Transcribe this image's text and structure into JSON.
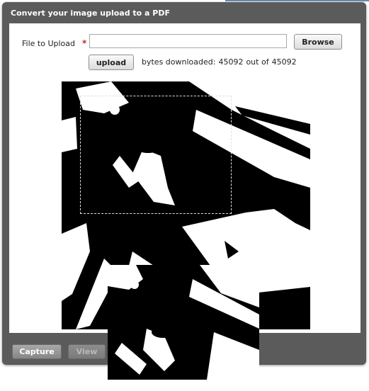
{
  "dialog": {
    "title": "Convert your image upload to a PDF"
  },
  "form": {
    "file_label": "File to Upload",
    "required_marker": "*",
    "file_value": "",
    "browse_label": "Browse",
    "upload_label": "upload",
    "bytes_prefix": "bytes downloaded:",
    "bytes_downloaded": "45092",
    "bytes_separator": "out of",
    "bytes_total": "45092"
  },
  "footer": {
    "capture_label": "Capture",
    "view_label": "View"
  },
  "colors": {
    "dialog_background": "#5b5b5b",
    "required_marker": "#c0262c",
    "preview_background": "#000000"
  }
}
